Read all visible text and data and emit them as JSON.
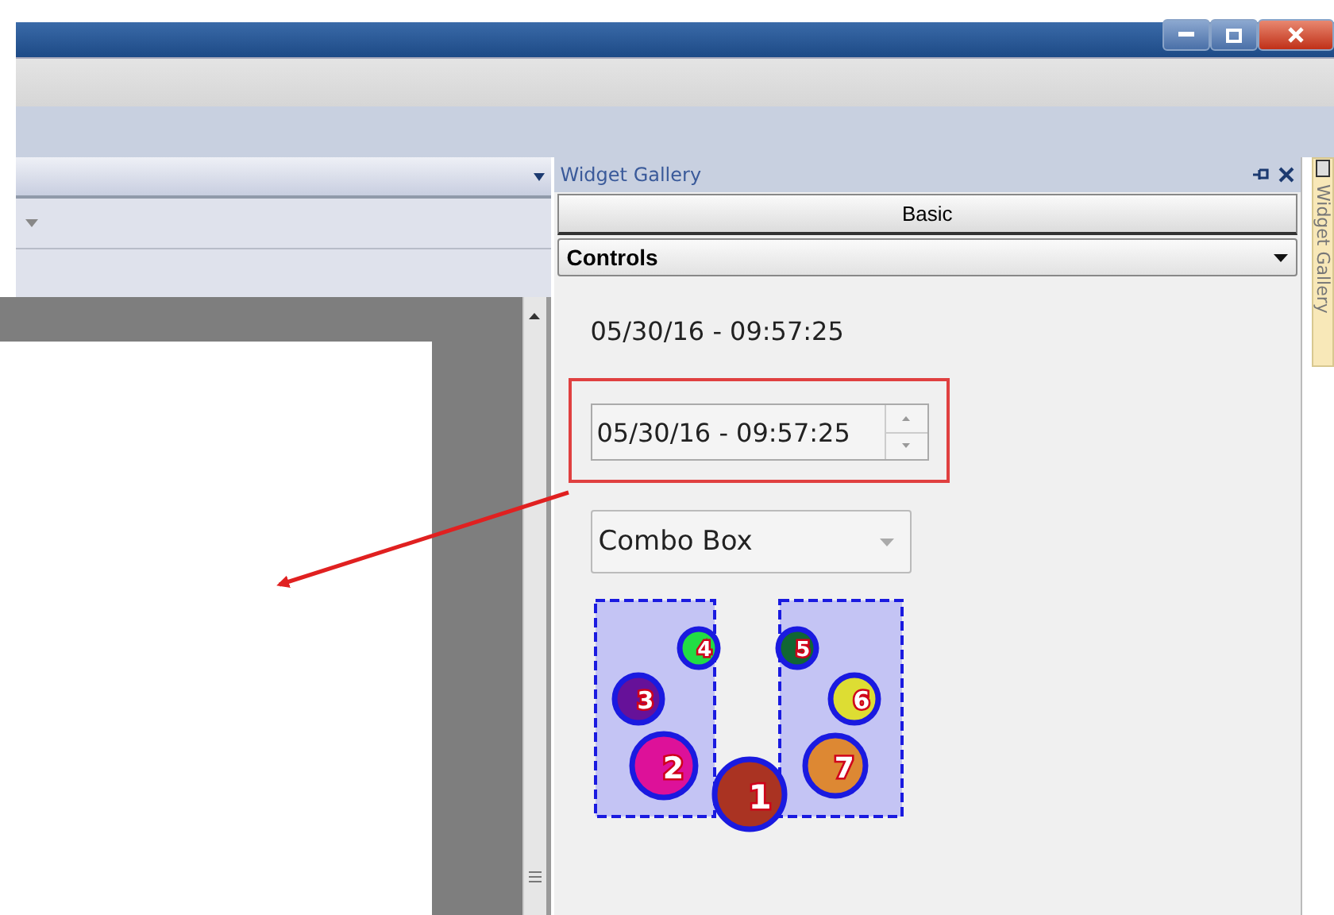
{
  "gallery": {
    "title": "Widget Gallery",
    "category_button": "Basic",
    "group_dropdown": {
      "value": "Controls"
    },
    "datetime_label": "05/30/16 - 09:57:25",
    "datetime_spinner": {
      "value": "05/30/16 - 09:57:25"
    },
    "combo_box": {
      "value": "Combo Box"
    },
    "circles": [
      {
        "label": "1",
        "color": "#aa3322"
      },
      {
        "label": "2",
        "color": "#dd1199"
      },
      {
        "label": "3",
        "color": "#661199"
      },
      {
        "label": "4",
        "color": "#22dd44"
      },
      {
        "label": "5",
        "color": "#116633"
      },
      {
        "label": "6",
        "color": "#dddd33"
      },
      {
        "label": "7",
        "color": "#dd8833"
      }
    ]
  },
  "side_tab": {
    "label": "Widget Gallery"
  }
}
